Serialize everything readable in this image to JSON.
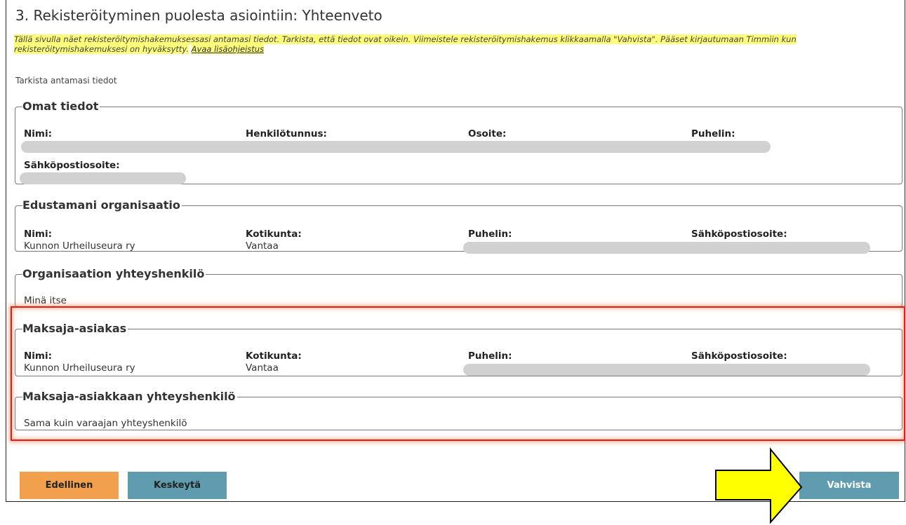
{
  "page": {
    "title": "3. Rekisteröityminen puolesta asiointiin: Yhteenveto",
    "notice_text": "Tällä sivulla näet rekisteröitymishakemuksessasi antamasi tiedot. Tarkista, että tiedot ovat oikein. Viimeistele rekisteröitymishakemus klikkaamalla \"Vahvista\". Pääset kirjautumaan Timmiin kun rekisteröitymishakemuksesi on hyväksytty.",
    "notice_link": "Avaa lisäohjeistus",
    "check_label": "Tarkista antamasi tiedot"
  },
  "own_info": {
    "legend": "Omat tiedot",
    "name_label": "Nimi:",
    "ssn_label": "Henkilötunnus:",
    "address_label": "Osoite:",
    "phone_label": "Puhelin:",
    "email_label": "Sähköpostiosoite:"
  },
  "organization": {
    "legend": "Edustamani organisaatio",
    "name_label": "Nimi:",
    "name_value": "Kunnon Urheiluseura ry",
    "municipality_label": "Kotikunta:",
    "municipality_value": "Vantaa",
    "phone_label": "Puhelin:",
    "email_label": "Sähköpostiosoite:"
  },
  "org_contact": {
    "legend": "Organisaation yhteyshenkilö",
    "value": "Minä itse"
  },
  "payer": {
    "legend": "Maksaja-asiakas",
    "name_label": "Nimi:",
    "name_value": "Kunnon Urheiluseura ry",
    "municipality_label": "Kotikunta:",
    "municipality_value": "Vantaa",
    "phone_label": "Puhelin:",
    "email_label": "Sähköpostiosoite:"
  },
  "payer_contact": {
    "legend": "Maksaja-asiakkaan yhteyshenkilö",
    "value": "Sama kuin varaajan yhteyshenkilö"
  },
  "buttons": {
    "previous": "Edellinen",
    "abort": "Keskeytä",
    "confirm": "Vahvista"
  },
  "colors": {
    "previous_button": "#f2a04e",
    "secondary_button": "#5f9cb0",
    "highlight_border": "#e31b1b",
    "arrow_fill": "#ffff00",
    "notice_highlight": "#fcfc7a"
  }
}
